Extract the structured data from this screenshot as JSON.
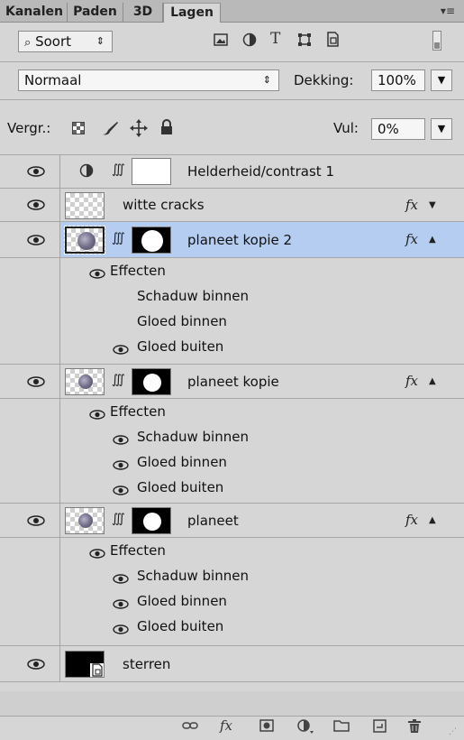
{
  "tabs": [
    "Kanalen",
    "Paden",
    "3D",
    "Lagen"
  ],
  "panel_menu_icon": "panel-menu-icon",
  "filter": {
    "search_symbol": "⌕",
    "kind_label": "Soort",
    "icons": [
      "image-filter-icon",
      "adjustment-filter-icon",
      "type-filter-icon",
      "shape-filter-icon",
      "smart-object-filter-icon",
      "filter-toggle-icon"
    ]
  },
  "blend": {
    "mode": "Normaal",
    "opacity_label": "Dekking:",
    "opacity_value": "100%"
  },
  "lock": {
    "label": "Vergr.:",
    "icons": [
      "lock-transparent-icon",
      "lock-paint-icon",
      "lock-position-icon",
      "lock-all-icon"
    ],
    "fill_label": "Vul:",
    "fill_value": "0%"
  },
  "layers": [
    {
      "name": "Helderheid/contrast 1",
      "type": "adjustment"
    },
    {
      "name": "witte cracks",
      "type": "pixel",
      "fx": "fx"
    },
    {
      "name": "planeet kopie 2",
      "type": "masked",
      "fx": "fx",
      "selected": true,
      "effects_label": "Effecten",
      "effects": [
        {
          "name": "Schaduw binnen",
          "visible": false
        },
        {
          "name": "Gloed binnen",
          "visible": false
        },
        {
          "name": "Gloed buiten",
          "visible": true
        }
      ]
    },
    {
      "name": "planeet kopie",
      "type": "masked",
      "fx": "fx",
      "effects_label": "Effecten",
      "effects": [
        {
          "name": "Schaduw binnen",
          "visible": true
        },
        {
          "name": "Gloed binnen",
          "visible": true
        },
        {
          "name": "Gloed buiten",
          "visible": true
        }
      ]
    },
    {
      "name": "planeet",
      "type": "masked",
      "fx": "fx",
      "effects_label": "Effecten",
      "effects": [
        {
          "name": "Schaduw binnen",
          "visible": true
        },
        {
          "name": "Gloed binnen",
          "visible": true
        },
        {
          "name": "Gloed buiten",
          "visible": true
        }
      ]
    },
    {
      "name": "sterren",
      "type": "smart-object"
    }
  ],
  "bottom_icons": [
    "link-layers-icon",
    "add-style-icon",
    "add-mask-icon",
    "new-adjustment-icon",
    "new-group-icon",
    "new-layer-icon",
    "delete-layer-icon"
  ],
  "fx_text": "fx",
  "colors": {
    "selected_row": "#b5cdf0",
    "panel": "#d6d6d6"
  }
}
